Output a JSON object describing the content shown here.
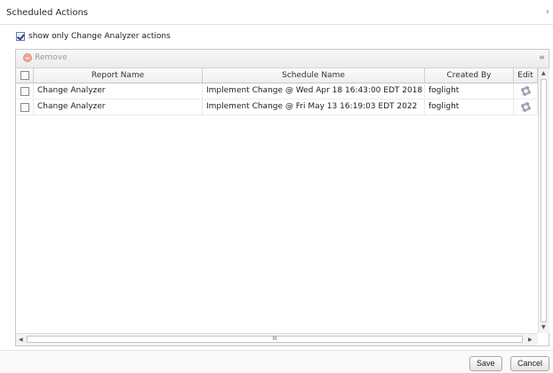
{
  "dialog": {
    "title": "Scheduled Actions",
    "close_glyph": "›"
  },
  "filter": {
    "checked": true,
    "label": "show only Change Analyzer actions"
  },
  "toolbar": {
    "remove_label": "Remove",
    "remove_icon": "remove-icon",
    "columns_icon": "columns-menu-icon",
    "columns_glyph": "≡"
  },
  "table": {
    "columns": [
      "Report Name",
      "Schedule Name",
      "Created By",
      "Edit"
    ],
    "rows": [
      {
        "report_name": "Change Analyzer",
        "schedule_name": "Implement Change @ Wed Apr 18 16:43:00 EDT 2018",
        "created_by": "foglight",
        "edit_icon": "gear-icon"
      },
      {
        "report_name": "Change Analyzer",
        "schedule_name": "Implement Change @ Fri May 13 16:19:03 EDT 2022",
        "created_by": "foglight",
        "edit_icon": "gear-icon"
      }
    ]
  },
  "scrollbar": {
    "up": "▲",
    "down": "▼",
    "left": "◀",
    "right": "▶",
    "grip": "III"
  },
  "footer": {
    "save_label": "Save",
    "cancel_label": "Cancel"
  }
}
